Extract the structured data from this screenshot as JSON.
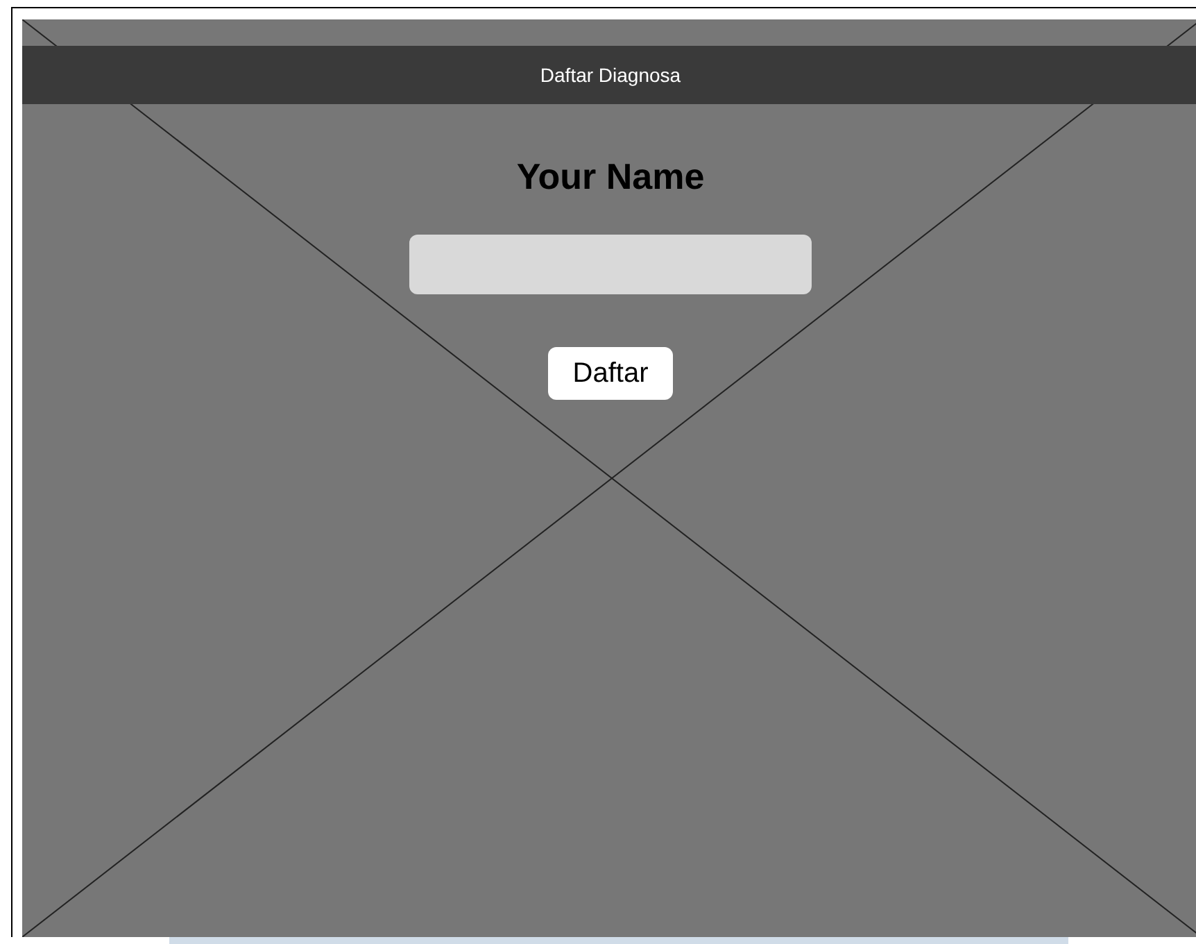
{
  "header": {
    "title": "Daftar Diagnosa"
  },
  "form": {
    "heading": "Your Name",
    "button": "Daftar"
  }
}
